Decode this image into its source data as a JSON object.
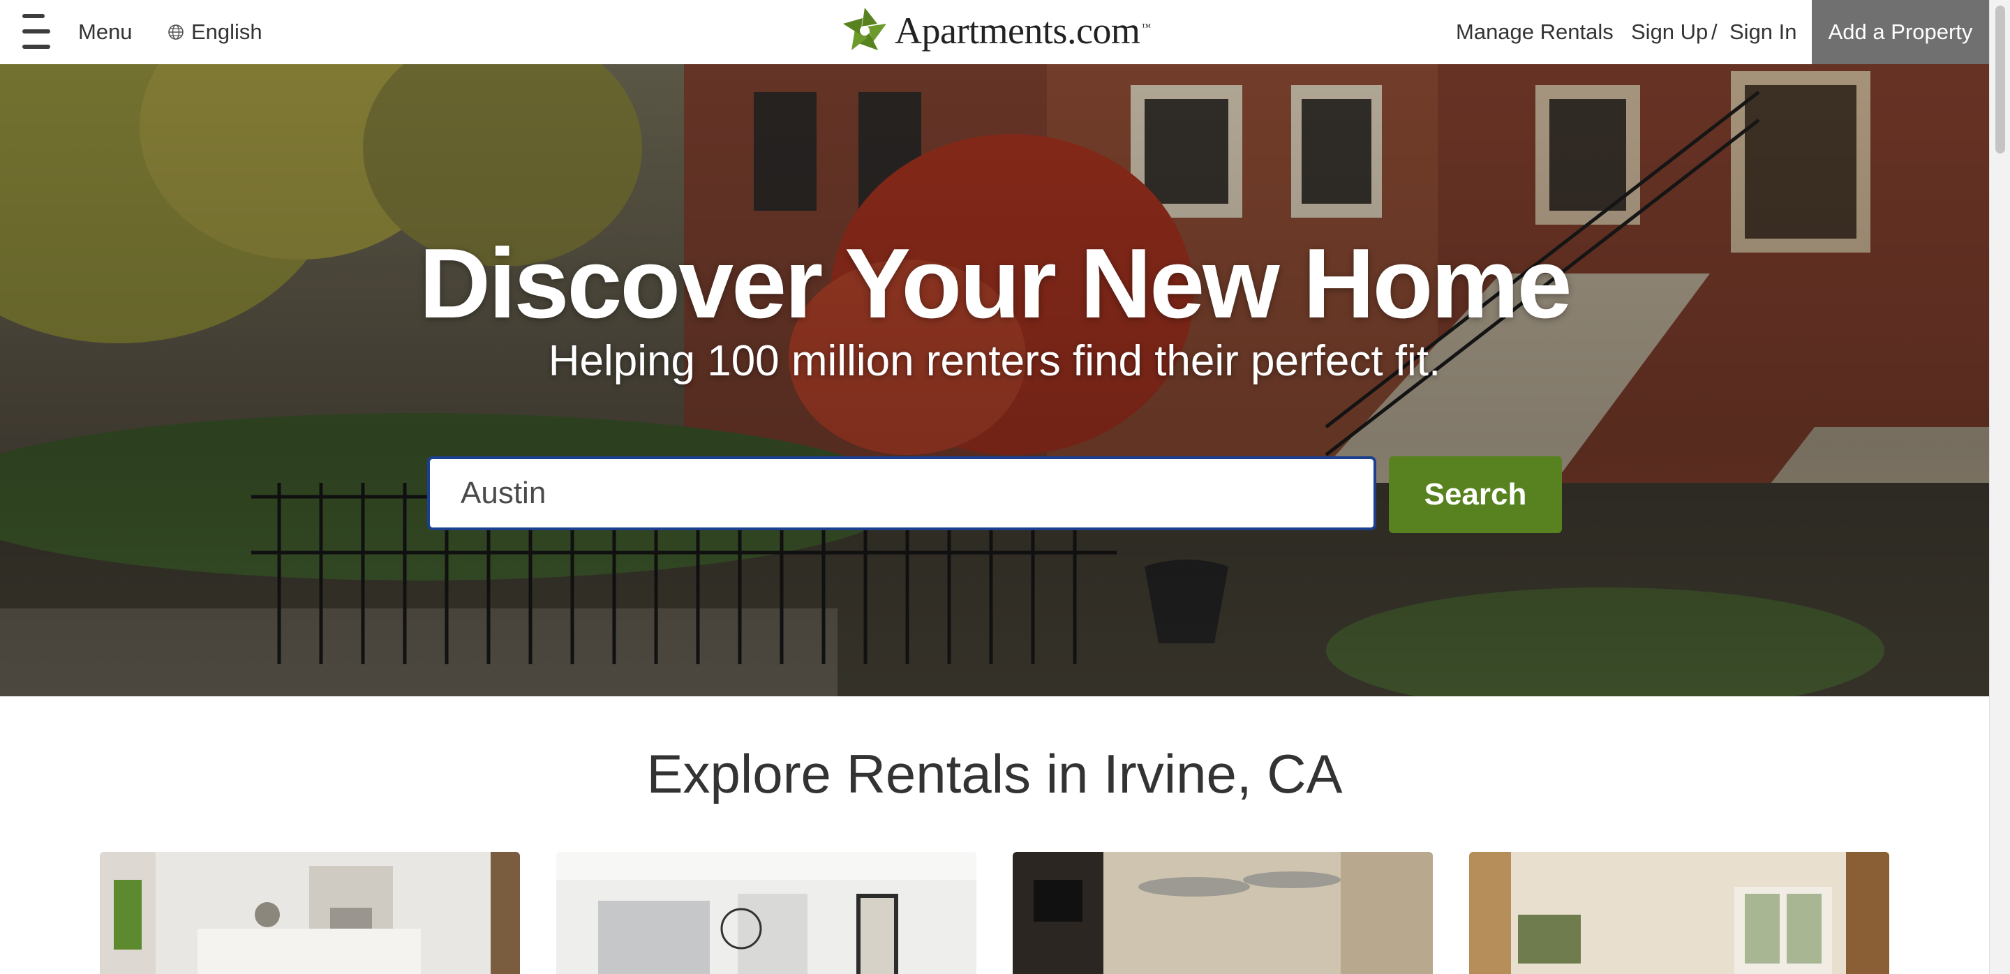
{
  "header": {
    "menu_label": "Menu",
    "language_label": "English",
    "logo_text": "Apartments.com",
    "logo_tm": "™",
    "manage_rentals": "Manage Rentals",
    "sign_up": "Sign Up",
    "separator": "/",
    "sign_in": "Sign In",
    "add_property": "Add a Property"
  },
  "hero": {
    "title": "Discover Your New Home",
    "subtitle": "Helping 100 million renters find their perfect fit.",
    "search_value": "Austin",
    "search_button": "Search"
  },
  "explore": {
    "title": "Explore Rentals in Irvine, CA",
    "cards": [
      {
        "image": "kitchen-photo"
      },
      {
        "image": "hallway-photo"
      },
      {
        "image": "lounge-photo"
      },
      {
        "image": "living-room-photo"
      }
    ]
  },
  "colors": {
    "brand_green": "#58821f",
    "search_border": "#1c3f8f",
    "add_property_bg": "#707070"
  },
  "icons": {
    "menu": "hamburger-icon",
    "language": "globe-icon",
    "logo": "apartments-logo-icon"
  }
}
